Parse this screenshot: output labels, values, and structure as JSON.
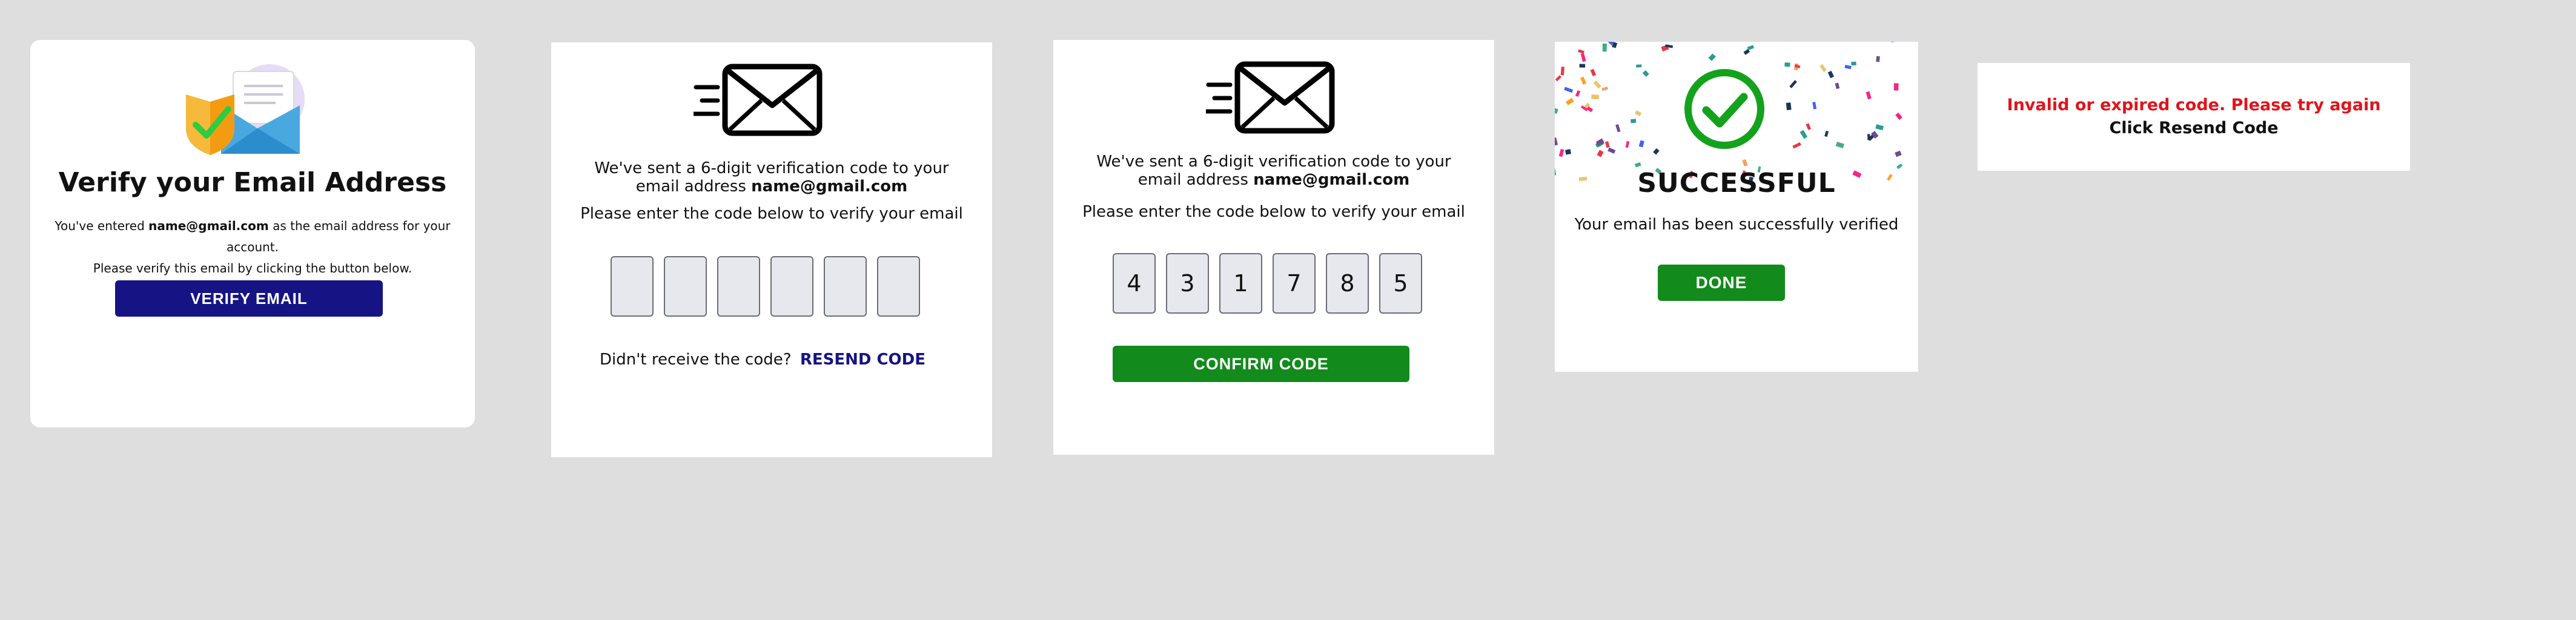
{
  "colors": {
    "background": "#dedede",
    "card": "#ffffff",
    "primary_button": "#161484",
    "success_button": "#128a1c",
    "link": "#161484",
    "error_text": "#e0141c",
    "digit_box": "#e7e8ee"
  },
  "verify_card": {
    "illustration": "email-shield-check-icon",
    "title": "Verify your Email Address",
    "line1_prefix": "You've entered ",
    "line1_email": "name@gmail.com",
    "line1_suffix": " as the email address for your account.",
    "line2": "Please verify this email by clicking the button below.",
    "button": "VERIFY EMAIL"
  },
  "code_entry_card": {
    "icon": "sent-envelope-icon",
    "sent_line1": "We've sent a 6-digit verification code to your",
    "sent_line2_prefix": "email address ",
    "sent_line2_email": "name@gmail.com",
    "instruction": "Please enter the code below to verify your email",
    "digits": [
      "",
      "",
      "",
      "",
      "",
      ""
    ],
    "resend_prompt": "Didn't receive the code?",
    "resend_link": "RESEND CODE"
  },
  "code_filled_card": {
    "icon": "sent-envelope-icon",
    "sent_line1": "We've sent a 6-digit verification code to your",
    "sent_line2_prefix": "email address ",
    "sent_line2_email": "name@gmail.com",
    "instruction": "Please enter the code below to verify your email",
    "digits": [
      "4",
      "3",
      "1",
      "7",
      "8",
      "5"
    ],
    "button": "CONFIRM CODE"
  },
  "success_card": {
    "icon": "check-circle-icon",
    "title": "SUCCESSFUL",
    "message": "Your email has been successfully verified",
    "button": "DONE"
  },
  "error_card": {
    "error": "Invalid or expired code. Please try again",
    "hint": "Click Resend Code"
  }
}
